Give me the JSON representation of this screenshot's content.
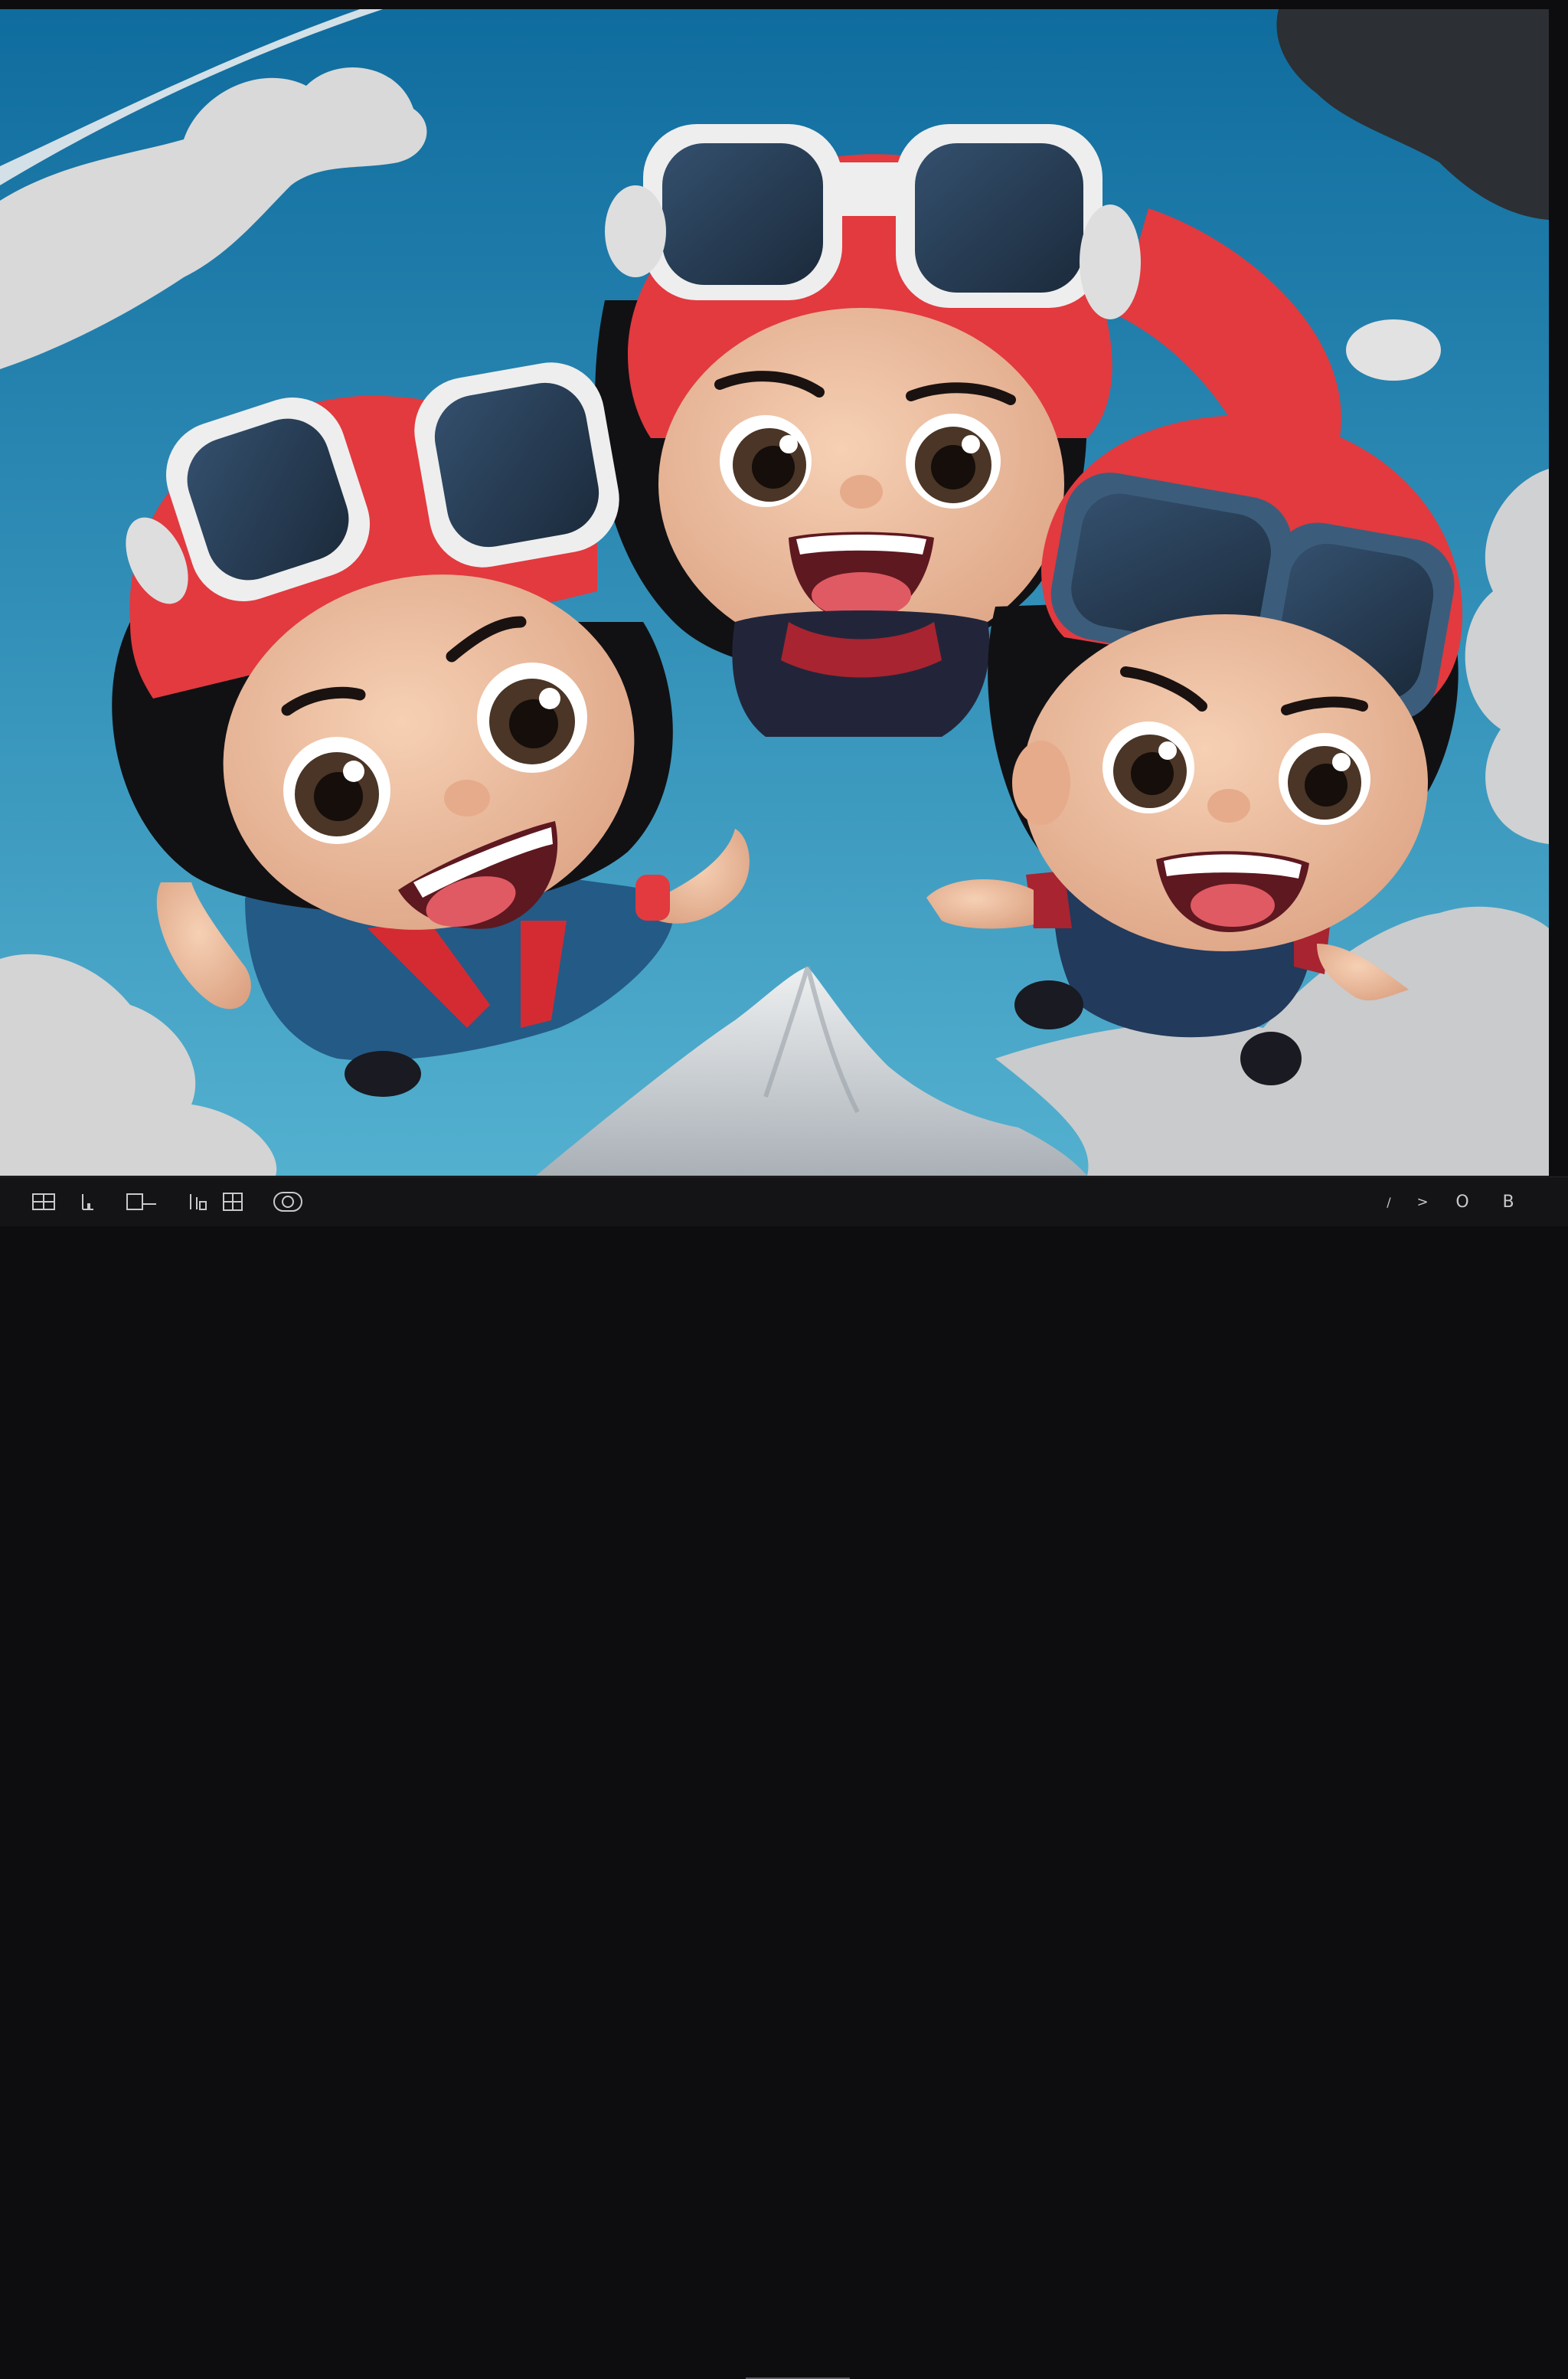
{
  "image": {
    "description_alt": "",
    "colors": {
      "sky_top": "#0f6c9e",
      "sky_bottom": "#53b0cf",
      "helmet_red": "#e23a3f",
      "goggle_frame": "#eeeeee",
      "goggle_lens": "#24384f",
      "suit_blue": "#245a86",
      "cloud": "#d8d8d8",
      "mountain": "#cfd3d6",
      "skin": "#f0c3a4",
      "hair": "#111114"
    }
  },
  "toolbar": {
    "left_icons": [
      "grid-view-icon",
      "stats-icon",
      "frame-icon",
      "layers-icon",
      "image-icon",
      "loop-icon"
    ],
    "right_labels": {
      "slash": "/",
      "next": ">",
      "o": "O",
      "b": "B"
    }
  }
}
